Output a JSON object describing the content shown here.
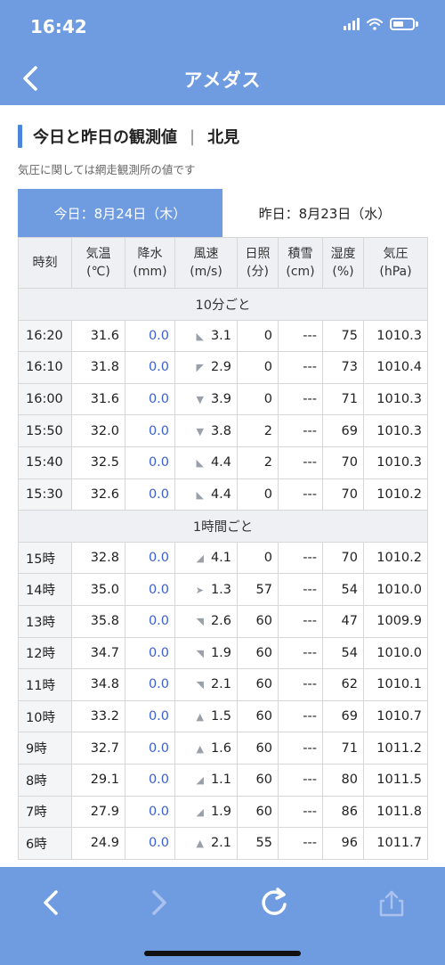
{
  "status_bar": {
    "time": "16:42"
  },
  "nav": {
    "title": "アメダス"
  },
  "heading": {
    "title": "今日と昨日の観測値",
    "separator": "|",
    "station": "北見"
  },
  "note": "気圧に関しては網走観測所の値です",
  "tabs": [
    {
      "label": "今日：8月24日（木）",
      "active": true
    },
    {
      "label": "昨日：8月23日（水）",
      "active": false
    }
  ],
  "columns": [
    {
      "line1": "時刻",
      "line2": ""
    },
    {
      "line1": "気温",
      "line2": "(℃)"
    },
    {
      "line1": "降水",
      "line2": "(mm)"
    },
    {
      "line1": "風速",
      "line2": "(m/s)"
    },
    {
      "line1": "日照",
      "line2": "(分)"
    },
    {
      "line1": "積雪",
      "line2": "(cm)"
    },
    {
      "line1": "湿度",
      "line2": "(%)"
    },
    {
      "line1": "気圧",
      "line2": "(hPa)"
    }
  ],
  "sections": {
    "ten_min": "10分ごと",
    "hourly": "1時間ごと"
  },
  "rows_10min": [
    {
      "time": "16:20",
      "temp": "31.6",
      "precip": "0.0",
      "wind_arrow": "◣",
      "wind": "3.1",
      "sun": "0",
      "snow": "---",
      "humidity": "75",
      "pressure": "1010.3"
    },
    {
      "time": "16:10",
      "temp": "31.8",
      "precip": "0.0",
      "wind_arrow": "◤",
      "wind": "2.9",
      "sun": "0",
      "snow": "---",
      "humidity": "73",
      "pressure": "1010.4"
    },
    {
      "time": "16:00",
      "temp": "31.6",
      "precip": "0.0",
      "wind_arrow": "▼",
      "wind": "3.9",
      "sun": "0",
      "snow": "---",
      "humidity": "71",
      "pressure": "1010.3"
    },
    {
      "time": "15:50",
      "temp": "32.0",
      "precip": "0.0",
      "wind_arrow": "▼",
      "wind": "3.8",
      "sun": "2",
      "snow": "---",
      "humidity": "69",
      "pressure": "1010.3"
    },
    {
      "time": "15:40",
      "temp": "32.5",
      "precip": "0.0",
      "wind_arrow": "◣",
      "wind": "4.4",
      "sun": "2",
      "snow": "---",
      "humidity": "70",
      "pressure": "1010.3"
    },
    {
      "time": "15:30",
      "temp": "32.6",
      "precip": "0.0",
      "wind_arrow": "◣",
      "wind": "4.4",
      "sun": "0",
      "snow": "---",
      "humidity": "70",
      "pressure": "1010.2"
    }
  ],
  "rows_hourly": [
    {
      "time": "15時",
      "temp": "32.8",
      "precip": "0.0",
      "wind_arrow": "◢",
      "wind": "4.1",
      "sun": "0",
      "snow": "---",
      "humidity": "70",
      "pressure": "1010.2"
    },
    {
      "time": "14時",
      "temp": "35.0",
      "precip": "0.0",
      "wind_arrow": "➤",
      "wind": "1.3",
      "sun": "57",
      "snow": "---",
      "humidity": "54",
      "pressure": "1010.0"
    },
    {
      "time": "13時",
      "temp": "35.8",
      "precip": "0.0",
      "wind_arrow": "◥",
      "wind": "2.6",
      "sun": "60",
      "snow": "---",
      "humidity": "47",
      "pressure": "1009.9"
    },
    {
      "time": "12時",
      "temp": "34.7",
      "precip": "0.0",
      "wind_arrow": "◥",
      "wind": "1.9",
      "sun": "60",
      "snow": "---",
      "humidity": "54",
      "pressure": "1010.0"
    },
    {
      "time": "11時",
      "temp": "34.8",
      "precip": "0.0",
      "wind_arrow": "◥",
      "wind": "2.1",
      "sun": "60",
      "snow": "---",
      "humidity": "62",
      "pressure": "1010.1"
    },
    {
      "time": "10時",
      "temp": "33.2",
      "precip": "0.0",
      "wind_arrow": "▲",
      "wind": "1.5",
      "sun": "60",
      "snow": "---",
      "humidity": "69",
      "pressure": "1010.7"
    },
    {
      "time": "9時",
      "temp": "32.7",
      "precip": "0.0",
      "wind_arrow": "▲",
      "wind": "1.6",
      "sun": "60",
      "snow": "---",
      "humidity": "71",
      "pressure": "1011.2"
    },
    {
      "time": "8時",
      "temp": "29.1",
      "precip": "0.0",
      "wind_arrow": "◢",
      "wind": "1.1",
      "sun": "60",
      "snow": "---",
      "humidity": "80",
      "pressure": "1011.5"
    },
    {
      "time": "7時",
      "temp": "27.9",
      "precip": "0.0",
      "wind_arrow": "◢",
      "wind": "1.9",
      "sun": "60",
      "snow": "---",
      "humidity": "86",
      "pressure": "1011.8"
    },
    {
      "time": "6時",
      "temp": "24.9",
      "precip": "0.0",
      "wind_arrow": "▲",
      "wind": "2.1",
      "sun": "55",
      "snow": "---",
      "humidity": "96",
      "pressure": "1011.7"
    }
  ],
  "colors": {
    "accent": "#6f9be0",
    "heading_bar": "#4b86dc",
    "precip": "#3a5fd0"
  },
  "toolbar": {
    "back_icon": "chevron-left-icon",
    "forward_icon": "chevron-right-icon",
    "reload_icon": "reload-icon",
    "share_icon": "share-icon"
  }
}
